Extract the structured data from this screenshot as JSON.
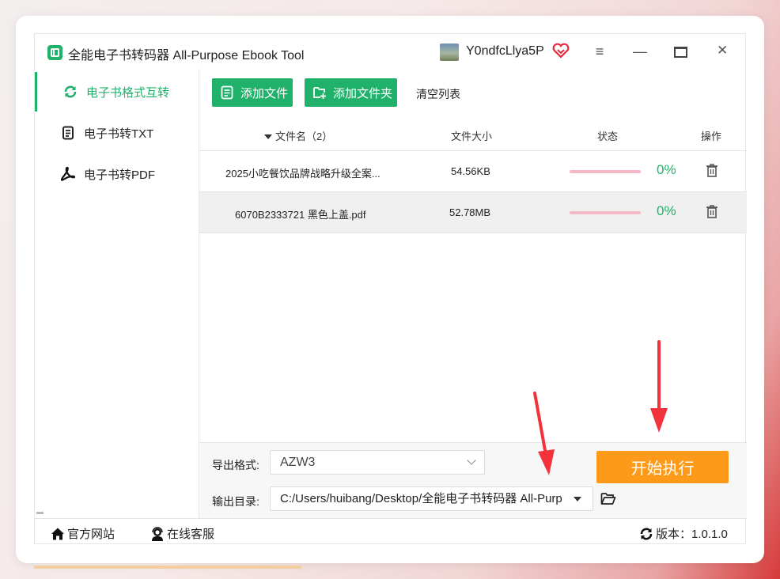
{
  "window": {
    "title": "全能电子书转码器 All-Purpose Ebook Tool",
    "username": "Y0ndfcLlya5P"
  },
  "sidebar": {
    "items": [
      {
        "label": "电子书格式互转",
        "icon": "refresh-icon",
        "active": true
      },
      {
        "label": "电子书转TXT",
        "icon": "document-icon",
        "active": false
      },
      {
        "label": "电子书转PDF",
        "icon": "acrobat-icon",
        "active": false
      }
    ]
  },
  "toolbar": {
    "add_file": "添加文件",
    "add_folder": "添加文件夹",
    "clear_list": "清空列表"
  },
  "table": {
    "headers": {
      "name": "文件名（2）",
      "size": "文件大小",
      "status": "状态",
      "action": "操作"
    },
    "rows": [
      {
        "name": "2025小吃餐饮品牌战略升级全案...",
        "size": "54.56KB",
        "progress_label": "0%",
        "progress": 0
      },
      {
        "name": "6070B2333721 黑色上盖.pdf",
        "size": "52.78MB",
        "progress_label": "0%",
        "progress": 0
      }
    ]
  },
  "settings": {
    "format_label": "导出格式:",
    "format_value": "AZW3",
    "dir_label": "输出目录:",
    "dir_value": "C:/Users/huibang/Desktop/全能电子书转码器 All-Purpose Ebook Tool",
    "start_button": "开始执行"
  },
  "footer": {
    "website": "官方网站",
    "support": "在线客服",
    "version": "版本：1.0.1.0"
  },
  "colors": {
    "accent": "#20b26b",
    "start": "#fe9a1a",
    "arrow": "#f2333c",
    "progress_track": "#f4b8c6"
  }
}
